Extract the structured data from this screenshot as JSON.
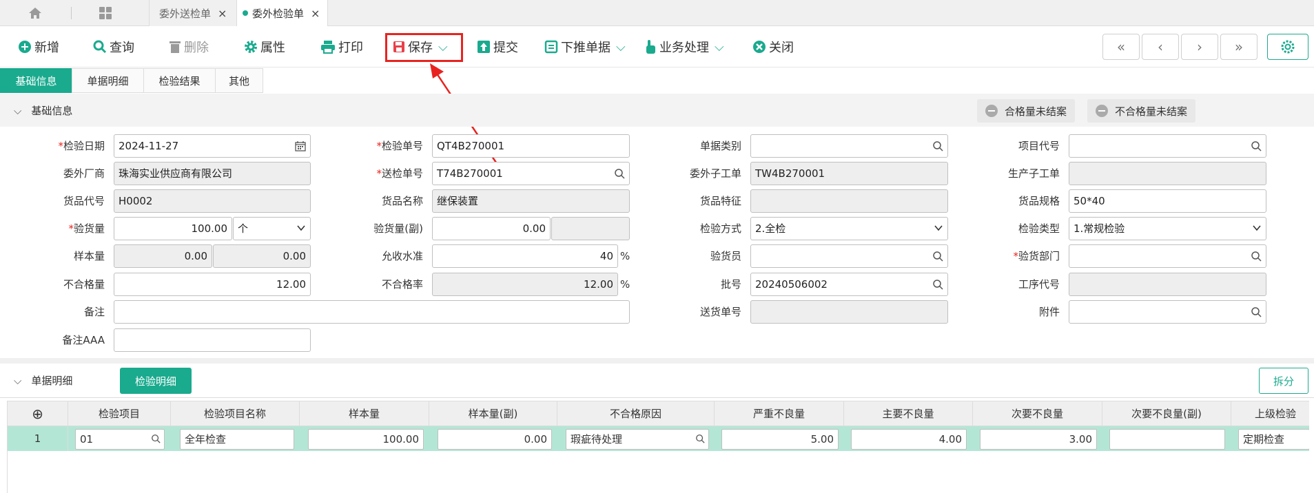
{
  "tabs": {
    "doc_tabs": [
      {
        "label": "委外送检单",
        "close": "×"
      },
      {
        "label": "委外检验单",
        "close": "×"
      }
    ]
  },
  "toolbar": {
    "new": "新增",
    "query": "查询",
    "delete": "删除",
    "properties": "属性",
    "print": "打印",
    "save": "保存",
    "submit": "提交",
    "push_down": "下推单据",
    "business": "业务处理",
    "close": "关闭",
    "nav": [
      "«",
      "‹",
      "›",
      "»"
    ]
  },
  "section_tabs": [
    "基础信息",
    "单据明细",
    "检验结果",
    "其他"
  ],
  "basic_section": {
    "title": "基础信息",
    "pills": [
      "合格量未结案",
      "不合格量未结案"
    ]
  },
  "form": {
    "inspect_date_label": "检验日期",
    "inspect_date": "2024-11-27",
    "inspect_no_label": "检验单号",
    "inspect_no": "QT4B270001",
    "doc_type_label": "单据类别",
    "doc_type": "",
    "project_code_label": "项目代号",
    "project_code": "",
    "vendor_label": "委外厂商",
    "vendor": "珠海实业供应商有限公司",
    "send_no_label": "送检单号",
    "send_no": "T74B270001",
    "sub_order_label": "委外子工单",
    "sub_order": "TW4B270001",
    "prod_sub_order_label": "生产子工单",
    "prod_sub_order": "",
    "item_code_label": "货品代号",
    "item_code": "H0002",
    "item_name_label": "货品名称",
    "item_name": "继保装置",
    "item_feature_label": "货品特征",
    "item_feature": "",
    "item_spec_label": "货品规格",
    "item_spec": "50*40",
    "qty_label": "验货量",
    "qty": "100.00",
    "unit": "个",
    "qty2_label": "验货量(副)",
    "qty2": "0.00",
    "qty2_unit": "",
    "method_label": "检验方式",
    "method": "2.全检",
    "type_label": "检验类型",
    "type": "1.常规检验",
    "sample_label": "样本量",
    "sample": "0.00",
    "sample2": "0.00",
    "accept_label": "允收水准",
    "accept": "40",
    "accept_pct": "%",
    "inspector_label": "验货员",
    "inspector": "",
    "dept_label": "验货部门",
    "dept": "",
    "defect_qty_label": "不合格量",
    "defect_qty": "12.00",
    "defect_rate_label": "不合格率",
    "defect_rate": "12.00",
    "defect_pct": "%",
    "batch_label": "批号",
    "batch": "20240506002",
    "process_label": "工序代号",
    "process": "",
    "remark_label": "备注",
    "remark": "",
    "delivery_label": "送货单号",
    "delivery": "",
    "attach_label": "附件",
    "attach": "",
    "remark_aaa_label": "备注AAA",
    "remark_aaa": ""
  },
  "detail": {
    "title": "单据明细",
    "tab": "检验明细",
    "split": "拆分",
    "add_icon": "⊕",
    "columns": [
      "检验项目",
      "检验项目名称",
      "样本量",
      "样本量(副)",
      "不合格原因",
      "严重不良量",
      "主要不良量",
      "次要不良量",
      "次要不良量(副)",
      "上级检验"
    ],
    "rows": [
      {
        "no": "1",
        "item": "01",
        "name": "全年检查",
        "sample": "100.00",
        "sample2": "0.00",
        "reason": "瑕疵待处理",
        "critical": "5.00",
        "major": "4.00",
        "minor": "3.00",
        "minor2": "",
        "parent": "定期检查"
      }
    ]
  },
  "colors": {
    "accent": "#1aaa8e",
    "highlight": "#e8231f",
    "row_selected": "#b4e6d6"
  }
}
